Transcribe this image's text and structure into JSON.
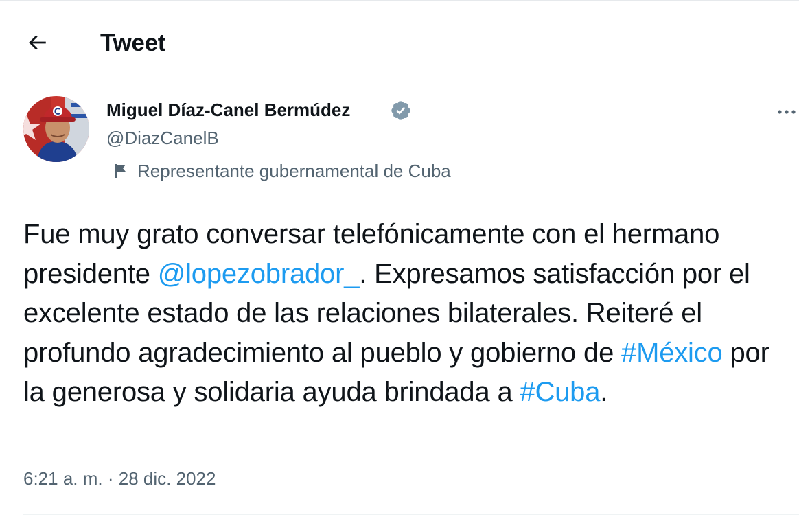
{
  "header": {
    "title": "Tweet",
    "back_icon": "arrow-left-icon"
  },
  "author": {
    "display_name": "Miguel Díaz-Canel Bermúdez",
    "handle": "@DiazCanelB",
    "verified_icon": "verified-badge-icon",
    "label": "Representante gubernamental de Cuba",
    "label_icon": "flag-icon"
  },
  "more_icon": "more-dots-icon",
  "tweet": {
    "segments": [
      {
        "text": "Fue muy grato conversar telefónicamente con el hermano presidente ",
        "link": false
      },
      {
        "text": "@lopezobrador_",
        "link": true
      },
      {
        "text": ". Expresamos satisfacción por el excelente estado de las relaciones bilaterales. Reiteré el profundo agradecimiento al pueblo y gobierno de ",
        "link": false
      },
      {
        "text": "#México",
        "link": true
      },
      {
        "text": " por la generosa y solidaria ayuda brindada a ",
        "link": false
      },
      {
        "text": "#Cuba",
        "link": true
      },
      {
        "text": ".",
        "link": false
      }
    ],
    "time": "6:21 a. m.",
    "separator": "·",
    "date": "28 dic. 2022"
  },
  "colors": {
    "link": "#1d9bf0",
    "secondary_text": "#536471",
    "verified": "#829aab"
  }
}
